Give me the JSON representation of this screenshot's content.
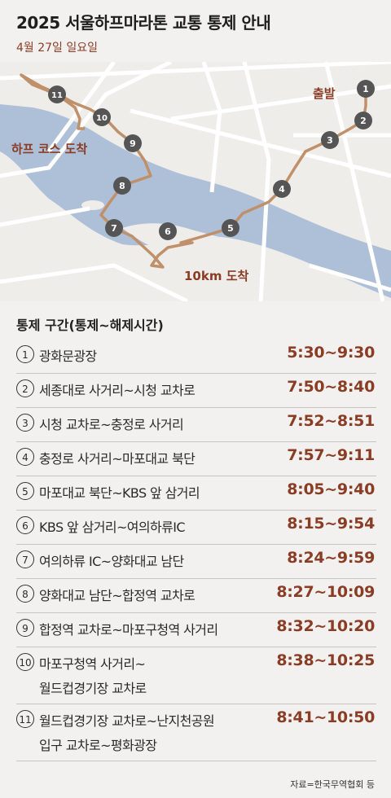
{
  "header": {
    "title": "2025 서울하프마라톤 교통 통제 안내",
    "date": "4월 27일 일요일"
  },
  "map": {
    "colors": {
      "river": "#a9bcd6",
      "land": "#f2f1ef",
      "road": "#ffffff",
      "route": "#c0906a",
      "marker": "#555555",
      "label": "#8a3d24"
    },
    "start_label": "출발",
    "half_finish_label": "하프 코스 도착",
    "tenk_finish_label": "10km 도착",
    "markers": [
      "1",
      "2",
      "3",
      "4",
      "5",
      "6",
      "7",
      "8",
      "9",
      "10",
      "11"
    ]
  },
  "section_title": "통제 구간(통제~해제시간)",
  "rows": [
    {
      "num": "1",
      "label": "광화문광장",
      "time": "5:30~9:30"
    },
    {
      "num": "2",
      "label": "세종대로 사거리~시청 교차로",
      "time": "7:50~8:40"
    },
    {
      "num": "3",
      "label": "시청 교차로~충정로 사거리",
      "time": "7:52~8:51"
    },
    {
      "num": "4",
      "label": "충정로 사거리~마포대교 북단",
      "time": "7:57~9:11"
    },
    {
      "num": "5",
      "label": "마포대교 북단~KBS 앞 삼거리",
      "time": "8:05~9:40"
    },
    {
      "num": "6",
      "label": "KBS 앞 삼거리~여의하류IC",
      "time": "8:15~9:54"
    },
    {
      "num": "7",
      "label": "여의하류 IC~양화대교 남단",
      "time": "8:24~9:59"
    },
    {
      "num": "8",
      "label": "양화대교 남단~합정역 교차로",
      "time": "8:27~10:09"
    },
    {
      "num": "9",
      "label": "합정역 교차로~마포구청역 사거리",
      "time": "8:32~10:20"
    },
    {
      "num": "10",
      "label": "마포구청역 사거리~",
      "label2": "월드컵경기장 교차로",
      "time": "8:38~10:25"
    },
    {
      "num": "11",
      "label": "월드컵경기장 교차로~난지천공원",
      "label2": "입구 교차로~평화광장",
      "time": "8:41~10:50"
    }
  ],
  "source": "자료=한국무역협회 등"
}
